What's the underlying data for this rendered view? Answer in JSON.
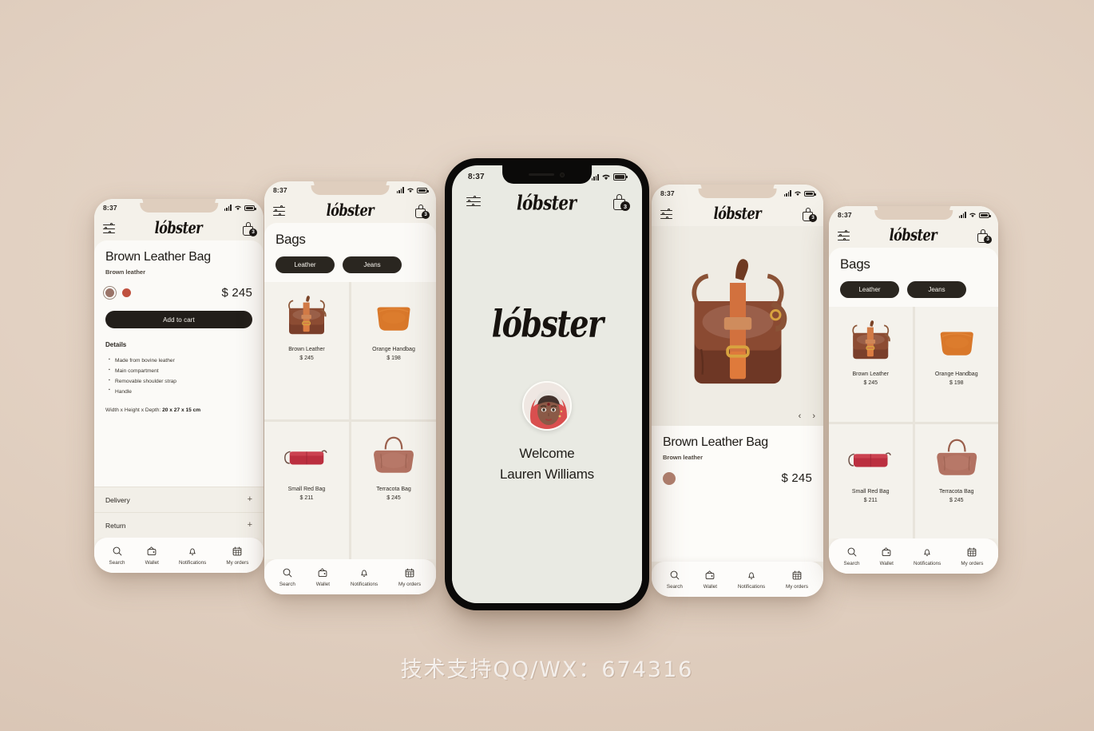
{
  "app": {
    "brand": "lóbster",
    "status_time": "8:37",
    "cart_count": "3"
  },
  "icons": {
    "filter": "sliders-icon",
    "cart": "shopping-bag-icon",
    "search": "search-icon",
    "wallet": "wallet-icon",
    "notifications": "bell-icon",
    "orders": "calendar-icon",
    "prev": "chevron-left-icon",
    "next": "chevron-right-icon"
  },
  "bottom_nav": [
    {
      "label": "Search",
      "icon": "search-icon"
    },
    {
      "label": "Wallet",
      "icon": "wallet-icon"
    },
    {
      "label": "Notifications",
      "icon": "bell-icon"
    },
    {
      "label": "My orders",
      "icon": "calendar-icon"
    }
  ],
  "product_detail": {
    "title": "Brown Leather Bag",
    "subtitle": "Brown leather",
    "price": "$ 245",
    "add_to_cart": "Add to cart",
    "details_heading": "Details",
    "features": [
      "Made from bovine leather",
      "Main compartment",
      "Removable shoulder strap",
      "Handle"
    ],
    "dimensions_label": "Width x Height x Depth:",
    "dimensions_value": "20 x 27 x 15 cm",
    "accordions": [
      {
        "label": "Delivery",
        "toggle": "+"
      },
      {
        "label": "Return",
        "toggle": "+"
      }
    ],
    "swatches": [
      {
        "name": "brown",
        "color": "#9a7468",
        "selected": true
      },
      {
        "name": "red",
        "color": "#c0513f",
        "selected": false
      }
    ]
  },
  "catalog": {
    "title": "Bags",
    "filters": [
      {
        "label": "Leather",
        "active": true
      },
      {
        "label": "Jeans",
        "active": false
      }
    ],
    "products": [
      {
        "name": "Brown Leather",
        "price": "$ 245",
        "art": "satchel"
      },
      {
        "name": "Orange Handbag",
        "price": "$ 198",
        "art": "orange"
      },
      {
        "name": "Small Red Bag",
        "price": "$ 211",
        "art": "red"
      },
      {
        "name": "Terracota Bag",
        "price": "$ 245",
        "art": "terra"
      }
    ]
  },
  "product_hero": {
    "title": "Brown Leather Bag",
    "subtitle": "Brown leather",
    "price": "$ 245",
    "prev": "‹",
    "next": "›",
    "swatch_color": "#b07f6e"
  },
  "welcome": {
    "logo": "lóbster",
    "greeting": "Welcome",
    "user_name": "Lauren Williams"
  },
  "watermark": "技术支持QQ/WX：674316",
  "colors": {
    "page_bg": "#e2d1c2",
    "phone_body": "#f4f1ea",
    "sheet": "#fbfaf7",
    "ink": "#1d1a16",
    "chip_bg": "#2a2620",
    "center_screen": "#e9eae3"
  }
}
